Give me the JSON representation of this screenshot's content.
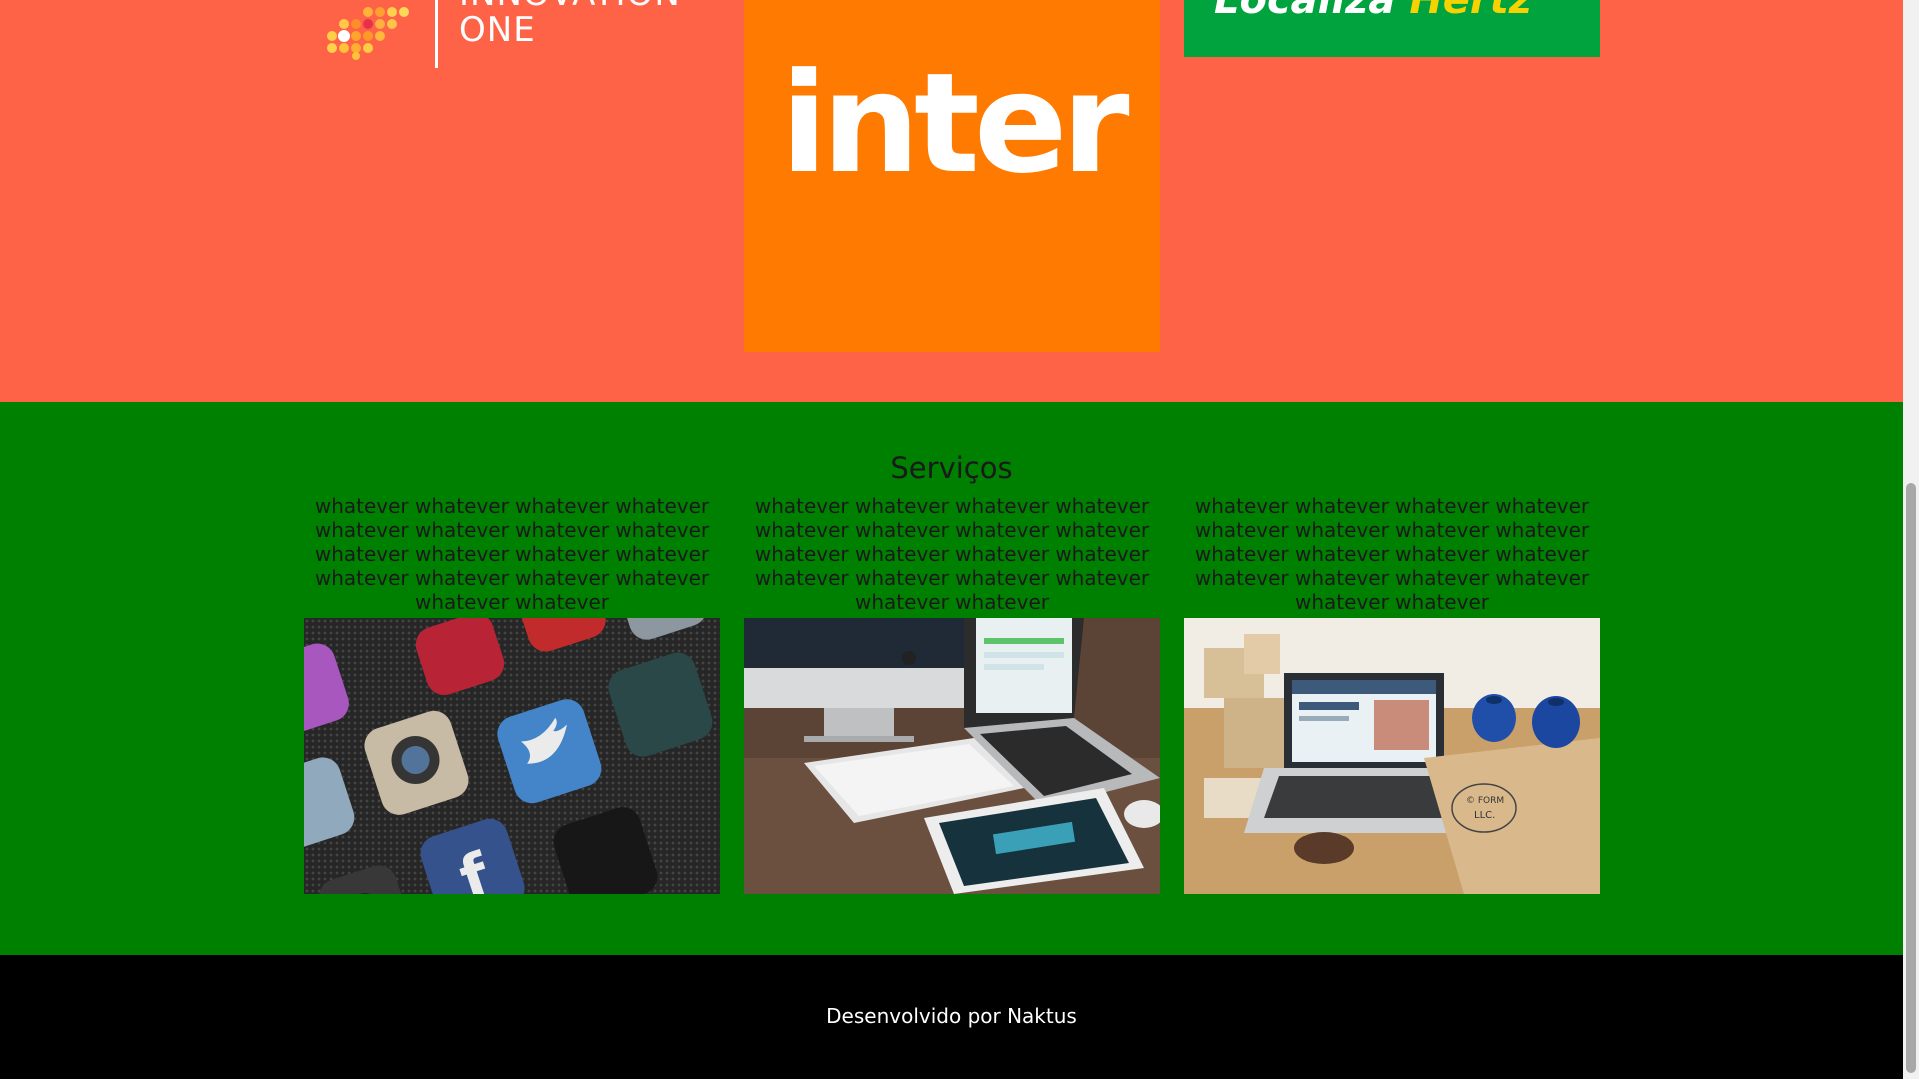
{
  "partners": {
    "logos": [
      {
        "name": "Digital Innovation One",
        "lines": [
          "INNOVATION",
          "ONE"
        ]
      },
      {
        "name": "Banco Inter",
        "word": "inter"
      },
      {
        "name": "Localiza Hertz",
        "word1": "Localiza",
        "word2": "Hertz"
      }
    ]
  },
  "services": {
    "title": "Serviços",
    "columns": [
      {
        "text": "whatever whatever whatever whatever whatever whatever whatever whatever whatever whatever whatever whatever whatever whatever whatever whatever whatever whatever",
        "image_alt": "smartphone app icons"
      },
      {
        "text": "whatever whatever whatever whatever whatever whatever whatever whatever whatever whatever whatever whatever whatever whatever whatever whatever whatever whatever",
        "image_alt": "iMac laptop and tablet on desk"
      },
      {
        "text": "whatever whatever whatever whatever whatever whatever whatever whatever whatever whatever whatever whatever whatever whatever whatever whatever whatever whatever",
        "image_alt": "laptop with boxes on table"
      }
    ]
  },
  "footer": {
    "text": "Desenvolvido por Naktus"
  },
  "colors": {
    "partners_bg": "#ff6347",
    "services_bg": "#008000",
    "footer_bg": "#000000",
    "inter_orange": "#ff7a00",
    "localiza_green": "#00a33e"
  }
}
